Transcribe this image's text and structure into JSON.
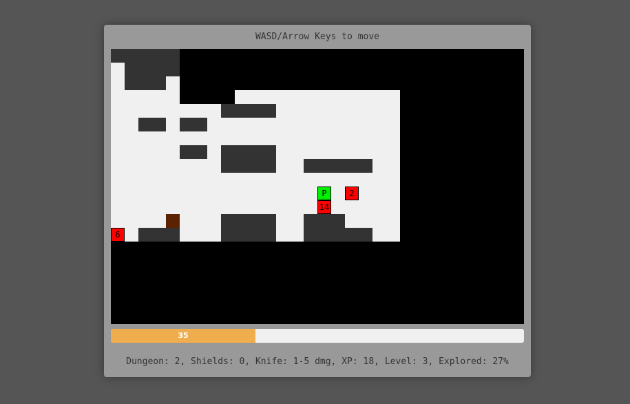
{
  "header": {
    "instructions": "WASD/Arrow Keys to move"
  },
  "board": {
    "cols": 30,
    "rows": 20,
    "colors": {
      "unexplored": "#000000",
      "floor": "#f0f0f0",
      "wall": "#333333",
      "enemy": "#ff0000",
      "player": "#00ee00",
      "weapon": "#5a2200"
    },
    "map": [
      "WWWWW.........................",
      "FWWWW.........................",
      "FWWWF.........................",
      "FFFFF.....FFFFFFFFFFF.........",
      "FFFFFFFWWWWFFFFFFFFFF.........",
      "FFFFFFFFFFFFFFFFFFFFF.........",
      "FFFFFFFFFFFFFFFFFFFFF.........",
      "FFFFFFFFFFFFFFFFFFFFF.........",
      "FFFFFFFFFFFFFFFFFFFFF.........",
      "FFFFFFFFFFFFFFFFFFFFF.........",
      "FFFFFFFFFFFFFFFFFFFFF.........",
      "FFFFFFFFFFFFFFFFFFFFF.........",
      "FFFFFFFFFFFFFFFFFFFFF.........",
      "FFFFFFFFFFFFFFFFFFFFF.........",
      "..........FFFFFFFFFFF.........",
      ".............................."
    ],
    "walls": [
      [
        1,
        5,
        1
      ],
      [
        2,
        6,
        1
      ],
      [
        4,
        1,
        2
      ],
      [
        4,
        2,
        2
      ],
      [
        5,
        1,
        2
      ],
      [
        5,
        2,
        2
      ],
      [
        7,
        4,
        4
      ],
      [
        8,
        4,
        4
      ],
      [
        9,
        4,
        4
      ],
      [
        10,
        7,
        4
      ],
      [
        11,
        7,
        4
      ],
      [
        12,
        7,
        4
      ],
      [
        13,
        7,
        4
      ],
      [
        14,
        4,
        3
      ],
      [
        15,
        4,
        3
      ],
      [
        16,
        4,
        3
      ],
      [
        17,
        4,
        3
      ],
      [
        18,
        4,
        3
      ],
      [
        19,
        4,
        3
      ],
      [
        2,
        8,
        2
      ],
      [
        2,
        9,
        2
      ],
      [
        3,
        8,
        2
      ]
    ],
    "entities": [
      {
        "type": "player",
        "label": "P",
        "col": 15,
        "row": 10
      },
      {
        "type": "enemy",
        "label": "2",
        "col": 17,
        "row": 10
      },
      {
        "type": "enemy",
        "label": "14",
        "col": 15,
        "row": 11
      },
      {
        "type": "enemy",
        "label": "6",
        "col": 0,
        "row": 13
      },
      {
        "type": "weapon",
        "label": "",
        "col": 4,
        "row": 12
      }
    ]
  },
  "health": {
    "value": "35",
    "max": 100,
    "fill_fraction": 0.35,
    "fill_color": "#f0ad4e"
  },
  "status": {
    "text": "Dungeon: 2, Shields: 0, Knife: 1-5 dmg, XP: 18, Level: 3, Explored: 27%"
  }
}
